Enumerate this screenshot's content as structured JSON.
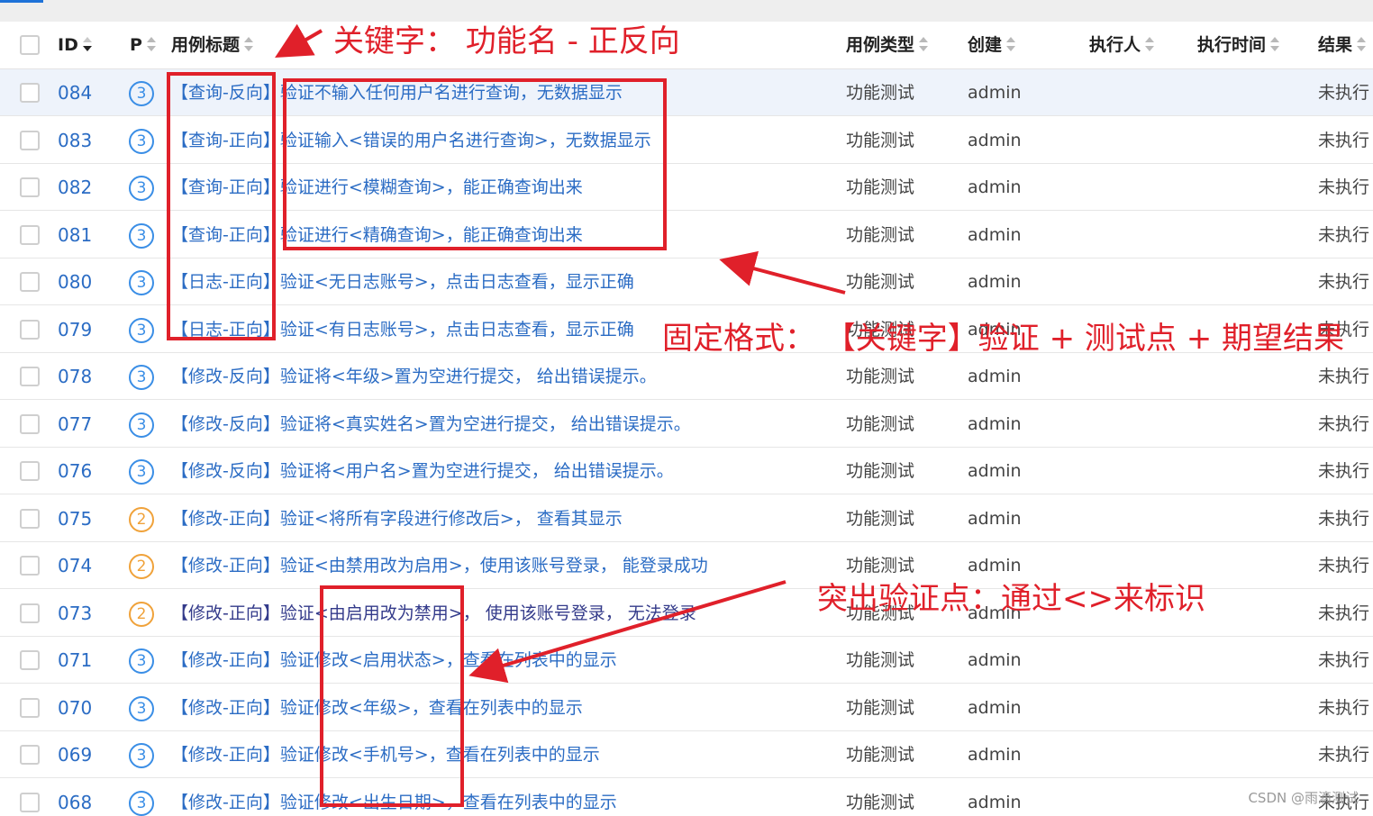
{
  "header": {
    "id": "ID",
    "priority": "P",
    "title": "用例标题",
    "type": "用例类型",
    "creator": "创建",
    "executor": "执行人",
    "exec_time": "执行时间",
    "result": "结果"
  },
  "rows": [
    {
      "id": "084",
      "priority": "3",
      "title": "【查询-反向】验证不输入任何用户名进行查询，无数据显示",
      "type": "功能测试",
      "creator": "admin",
      "result": "未执行"
    },
    {
      "id": "083",
      "priority": "3",
      "title": "【查询-正向】验证输入<错误的用户名进行查询>，无数据显示",
      "type": "功能测试",
      "creator": "admin",
      "result": "未执行"
    },
    {
      "id": "082",
      "priority": "3",
      "title": "【查询-正向】验证进行<模糊查询>，能正确查询出来",
      "type": "功能测试",
      "creator": "admin",
      "result": "未执行"
    },
    {
      "id": "081",
      "priority": "3",
      "title": "【查询-正向】验证进行<精确查询>，能正确查询出来",
      "type": "功能测试",
      "creator": "admin",
      "result": "未执行"
    },
    {
      "id": "080",
      "priority": "3",
      "title": "【日志-正向】验证<无日志账号>，点击日志查看，显示正确",
      "type": "功能测试",
      "creator": "admin",
      "result": "未执行"
    },
    {
      "id": "079",
      "priority": "3",
      "title": "【日志-正向】验证<有日志账号>，点击日志查看，显示正确",
      "type": "功能测试",
      "creator": "admin",
      "result": "未执行"
    },
    {
      "id": "078",
      "priority": "3",
      "title": "【修改-反向】验证将<年级>置为空进行提交， 给出错误提示。",
      "type": "功能测试",
      "creator": "admin",
      "result": "未执行"
    },
    {
      "id": "077",
      "priority": "3",
      "title": "【修改-反向】验证将<真实姓名>置为空进行提交， 给出错误提示。",
      "type": "功能测试",
      "creator": "admin",
      "result": "未执行"
    },
    {
      "id": "076",
      "priority": "3",
      "title": "【修改-反向】验证将<用户名>置为空进行提交， 给出错误提示。",
      "type": "功能测试",
      "creator": "admin",
      "result": "未执行"
    },
    {
      "id": "075",
      "priority": "2",
      "title": "【修改-正向】验证<将所有字段进行修改后>， 查看其显示",
      "type": "功能测试",
      "creator": "admin",
      "result": "未执行"
    },
    {
      "id": "074",
      "priority": "2",
      "title": "【修改-正向】验证<由禁用改为启用>，使用该账号登录， 能登录成功",
      "type": "功能测试",
      "creator": "admin",
      "result": "未执行"
    },
    {
      "id": "073",
      "priority": "2",
      "title": "【修改-正向】验证<由启用改为禁用>， 使用该账号登录， 无法登录",
      "type": "功能测试",
      "creator": "admin",
      "result": "未执行"
    },
    {
      "id": "071",
      "priority": "3",
      "title": "【修改-正向】验证修改<启用状态>，查看在列表中的显示",
      "type": "功能测试",
      "creator": "admin",
      "result": "未执行"
    },
    {
      "id": "070",
      "priority": "3",
      "title": "【修改-正向】验证修改<年级>，查看在列表中的显示",
      "type": "功能测试",
      "creator": "admin",
      "result": "未执行"
    },
    {
      "id": "069",
      "priority": "3",
      "title": "【修改-正向】验证修改<手机号>，查看在列表中的显示",
      "type": "功能测试",
      "creator": "admin",
      "result": "未执行"
    },
    {
      "id": "068",
      "priority": "3",
      "title": "【修改-正向】验证修改<出生日期>，查看在列表中的显示",
      "type": "功能测试",
      "creator": "admin",
      "result": "未执行"
    }
  ],
  "annotations": {
    "keyword": "关键字：  功能名 - 正反向",
    "format": "固定格式：  【关键字】验证 + 测试点 + 期望结果",
    "highlight": "突出验证点：通过<>来标识",
    "color": "#e0202a"
  },
  "watermark": "CSDN @雨滴测试"
}
